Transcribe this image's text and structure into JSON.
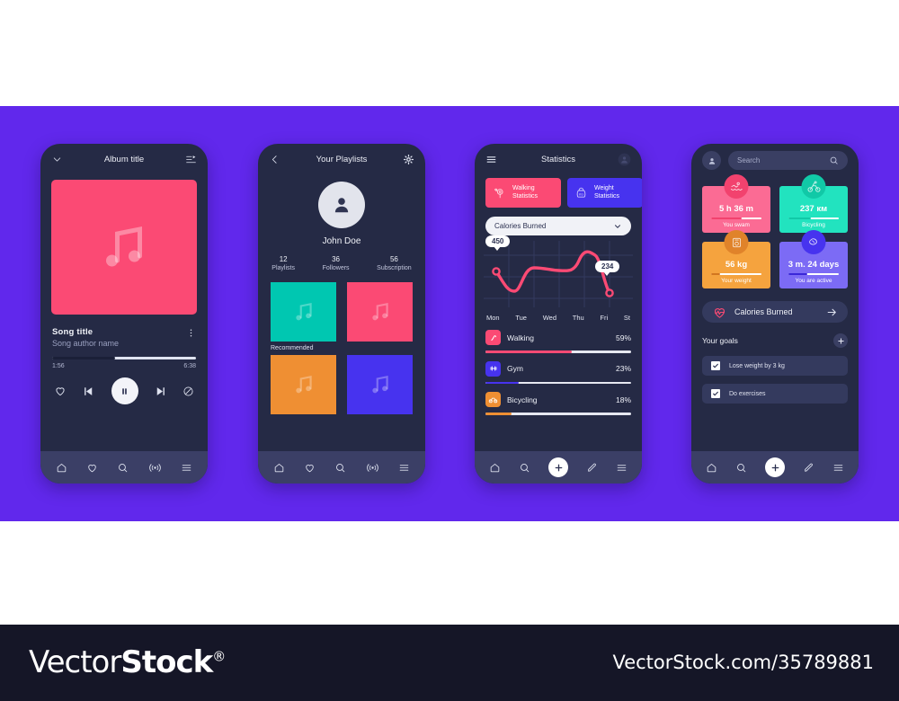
{
  "background": {
    "stage_color": "#6128ec",
    "page_color": "#ffffff"
  },
  "footer": {
    "logo_part1": "Vector",
    "logo_part2": "Stock",
    "logo_reg": "®",
    "url": "VectorStock.com/35789881"
  },
  "phone1": {
    "header": {
      "title": "Album title",
      "back_icon": "chevron-down-icon",
      "menu_icon": "playlist-icon"
    },
    "album_art_color": "#fb4a74",
    "song": {
      "title": "Song title",
      "author": "Song author name",
      "more_icon": "more-vertical-icon"
    },
    "progress": {
      "current": "1:56",
      "total": "6:38",
      "percent": 44
    },
    "controls": [
      "heart-icon",
      "previous-icon",
      "pause-icon",
      "next-icon",
      "block-icon"
    ],
    "nav": [
      "home-icon",
      "heart-icon",
      "search-icon",
      "radio-icon",
      "menu-icon"
    ]
  },
  "phone2": {
    "header": {
      "title": "Your Playlists",
      "back_icon": "chevron-left-icon",
      "settings_icon": "gear-icon"
    },
    "user": {
      "name": "John Doe",
      "avatar_icon": "person-icon"
    },
    "stats": [
      {
        "num": "12",
        "label": "Playlists"
      },
      {
        "num": "36",
        "label": "Followers"
      },
      {
        "num": "56",
        "label": "Subscription"
      }
    ],
    "recommended_label": "Recommended",
    "tiles": [
      {
        "color": "#00c7b1",
        "icon": "music-note-icon"
      },
      {
        "color": "#fb4a74",
        "icon": "music-note-icon"
      },
      {
        "color": "#ef8f33",
        "icon": "music-note-icon"
      },
      {
        "color": "#4733ef",
        "icon": "music-note-icon"
      }
    ],
    "nav": [
      "home-icon",
      "heart-icon",
      "search-icon",
      "radio-icon",
      "menu-icon"
    ]
  },
  "phone3": {
    "header": {
      "title": "Statistics",
      "menu_icon": "hamburger-icon",
      "avatar_icon": "person-icon"
    },
    "chips": [
      {
        "label": "Walking\nStatistics",
        "line1": "Walking",
        "line2": "Statistics",
        "color": "#fb4a74",
        "icon": "location-pin-icon"
      },
      {
        "label": "Weight\nStatistics",
        "line1": "Weight",
        "line2": "Statistics",
        "color": "#4733ef",
        "icon": "kettlebell-icon"
      },
      {
        "line1": "",
        "line2": "",
        "color": "#ef8f33",
        "icon": "none"
      }
    ],
    "select": {
      "value": "Calories Burned",
      "chevron_icon": "chevron-down-icon"
    },
    "chart_data": {
      "type": "line",
      "title": "Calories Burned",
      "categories": [
        "Mon",
        "Tue",
        "Wed",
        "Thu",
        "Fri",
        "St"
      ],
      "values": [
        450,
        300,
        395,
        390,
        470,
        234
      ],
      "labels": {
        "first": "450",
        "last": "234"
      },
      "line_color": "#fb4a74",
      "grid": true,
      "xlabel": "",
      "ylabel": "",
      "ylim": [
        200,
        500
      ]
    },
    "activities": [
      {
        "name": "Walking",
        "percent": "59%",
        "value": 59,
        "color": "#fb4a74",
        "icon": "shoe-icon"
      },
      {
        "name": "Gym",
        "percent": "23%",
        "value": 23,
        "color": "#4733ef",
        "icon": "dumbbell-icon"
      },
      {
        "name": "Bicycling",
        "percent": "18%",
        "value": 18,
        "color": "#ef8f33",
        "icon": "bicycle-icon"
      }
    ],
    "nav": [
      "home-icon",
      "search-icon",
      "plus-icon",
      "pencil-icon",
      "menu-icon"
    ]
  },
  "phone4": {
    "search": {
      "placeholder": "Search",
      "search_icon": "search-icon",
      "avatar_icon": "person-icon"
    },
    "metric_cards": [
      {
        "value": "5 h 36 m",
        "label": "You swam",
        "card_color": "#fb6b94",
        "badge_color": "#f2426e",
        "bar_color": "#f2426e",
        "bar_percent": 60,
        "icon": "swimmer-icon"
      },
      {
        "value": "237 км",
        "label": "Bicycling",
        "card_color": "#22e3bf",
        "badge_color": "#11c9a7",
        "bar_color": "#11c9a7",
        "bar_percent": 45,
        "icon": "bicycle-icon"
      },
      {
        "value": "56 kg",
        "label": "Your weight",
        "card_color": "#f5a33e",
        "badge_color": "#e0832a",
        "bar_color": "#d2761f",
        "bar_percent": 18,
        "icon": "scale-icon"
      },
      {
        "value": "3 m. 24 days",
        "label": "You are active",
        "card_color": "#7c6bf5",
        "badge_color": "#4733ef",
        "bar_color": "#3a27d8",
        "bar_percent": 38,
        "icon": "brain-icon"
      }
    ],
    "calories_row": {
      "label": "Calories Burned",
      "icon": "heart-pulse-icon",
      "arrow_icon": "arrow-right-icon"
    },
    "goals_header": {
      "title": "Your goals",
      "add_icon": "plus-icon"
    },
    "goals": [
      {
        "label": "Lose weight by 3 kg",
        "checked": true
      },
      {
        "label": "Do exercises",
        "checked": true
      }
    ],
    "nav": [
      "home-icon",
      "search-icon",
      "plus-icon",
      "pencil-icon",
      "menu-icon"
    ]
  }
}
